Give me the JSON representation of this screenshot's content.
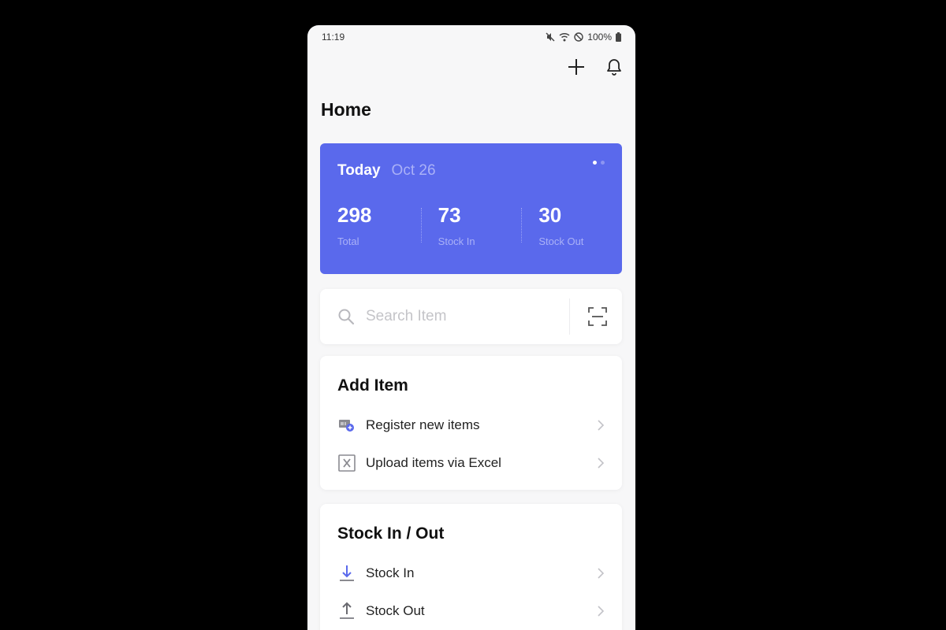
{
  "status_bar": {
    "time": "11:19",
    "battery": "100%",
    "icons": [
      "mute-icon",
      "wifi-icon",
      "dnd-icon",
      "battery-icon"
    ]
  },
  "header": {
    "title": "Home",
    "actions": [
      "add-icon",
      "bell-icon"
    ]
  },
  "summary": {
    "label": "Today",
    "date": "Oct 26",
    "stats": [
      {
        "value": "298",
        "label": "Total"
      },
      {
        "value": "73",
        "label": "Stock In"
      },
      {
        "value": "30",
        "label": "Stock Out"
      }
    ],
    "accent_color": "#5a69ec"
  },
  "search": {
    "placeholder": "Search Item",
    "icon": "search-icon",
    "scan_icon": "barcode-scan-icon"
  },
  "add_item": {
    "title": "Add Item",
    "items": [
      {
        "label": "Register new items",
        "icon": "register-item-icon"
      },
      {
        "label": "Upload items via Excel",
        "icon": "excel-icon"
      }
    ]
  },
  "stock_in_out": {
    "title": "Stock In / Out",
    "items": [
      {
        "label": "Stock In",
        "icon": "stock-in-icon"
      },
      {
        "label": "Stock Out",
        "icon": "stock-out-icon"
      }
    ]
  }
}
